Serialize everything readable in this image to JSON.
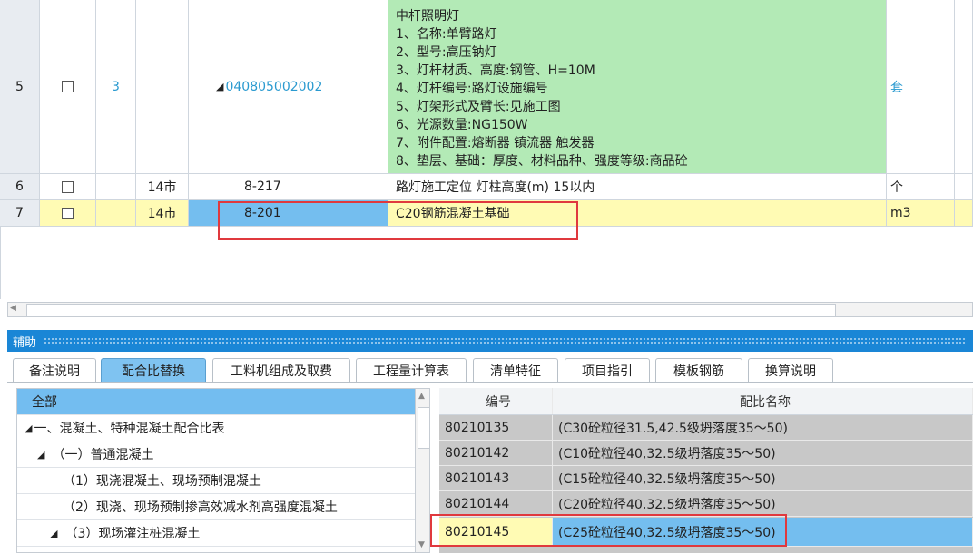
{
  "grid": {
    "rows": [
      {
        "num": "5",
        "seq": "3",
        "type": "",
        "code": "040805002002",
        "desc_lines": [
          "中杆照明灯",
          "1、名称:单臂路灯",
          "2、型号:高压钠灯",
          "3、灯杆材质、高度:钢管、H=10M",
          "4、灯杆编号:路灯设施编号",
          "5、灯架形式及臂长:见施工图",
          "6、光源数量:NG150W",
          "7、附件配置:熔断器 镇流器 触发器",
          "8、垫层、基础：厚度、材料品种、强度等级:商品砼"
        ],
        "unit": "套"
      },
      {
        "num": "6",
        "seq": "",
        "type": "14市",
        "code": "8-217",
        "name": "路灯施工定位 灯柱高度(m) 15以内",
        "unit": "个"
      },
      {
        "num": "7",
        "seq": "",
        "type": "14市",
        "code": "8-201",
        "name": "C20钢筋混凝土基础",
        "unit": "m3"
      }
    ]
  },
  "panel": {
    "title": "辅助",
    "tabs": [
      "备注说明",
      "配合比替换",
      "工料机组成及取费",
      "工程量计算表",
      "清单特征",
      "项目指引",
      "模板钢筋",
      "换算说明"
    ],
    "active_tab": "配合比替换"
  },
  "tree": {
    "header": "全部",
    "items": [
      "一、混凝土、特种混凝土配合比表",
      "（一）普通混凝土",
      "（1）现浇混凝土、现场预制混凝土",
      "（2）现浇、现场预制掺高效减水剂高强度混凝土",
      "（3）现场灌注桩混凝土"
    ]
  },
  "mix": {
    "headers": {
      "code": "编号",
      "name": "配比名称"
    },
    "rows": [
      {
        "code": "80210135",
        "name": "(C30砼粒径31.5,42.5级坍落度35～50)"
      },
      {
        "code": "80210142",
        "name": "(C10砼粒径40,32.5级坍落度35～50)"
      },
      {
        "code": "80210143",
        "name": "(C15砼粒径40,32.5级坍落度35～50)"
      },
      {
        "code": "80210144",
        "name": "(C20砼粒径40,32.5级坍落度35～50)"
      },
      {
        "code": "80210145",
        "name": "(C25砼粒径40,32.5级坍落度35～50)"
      }
    ]
  },
  "colors": {
    "green_row": "#b3eab6",
    "yellow_row": "#fffbb4",
    "selection": "#74beef",
    "panel_bar": "#1a86d6",
    "highlight_box": "#e0393e"
  }
}
